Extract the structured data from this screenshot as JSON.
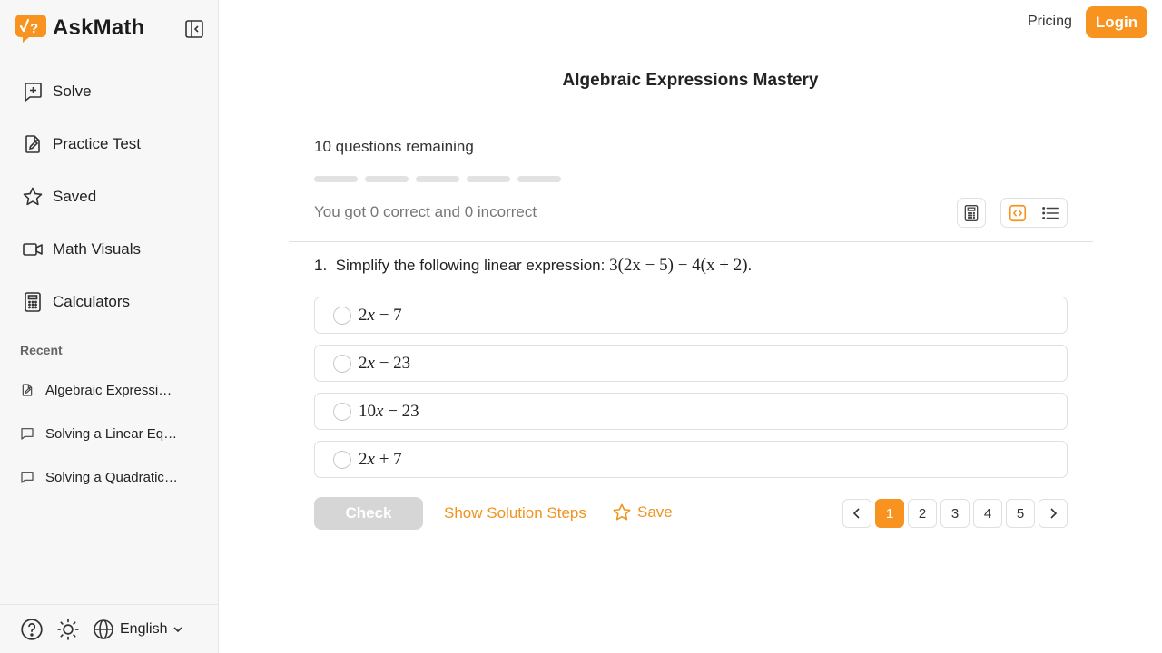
{
  "brand": {
    "name": "AskMath"
  },
  "nav": {
    "items": [
      {
        "label": "Solve",
        "icon": "solve-icon"
      },
      {
        "label": "Practice Test",
        "icon": "practice-test-icon"
      },
      {
        "label": "Saved",
        "icon": "star-icon"
      },
      {
        "label": "Math Visuals",
        "icon": "video-icon"
      },
      {
        "label": "Calculators",
        "icon": "calculator-icon"
      }
    ]
  },
  "recent": {
    "title": "Recent",
    "items": [
      {
        "label": "Algebraic Expressions Mastery",
        "icon": "practice-test-icon"
      },
      {
        "label": "Solving a Linear Equation",
        "icon": "chat-icon"
      },
      {
        "label": "Solving a Quadratic Equation",
        "icon": "chat-icon"
      }
    ]
  },
  "footer": {
    "language": "English"
  },
  "header": {
    "pricing": "Pricing",
    "login": "Login"
  },
  "colors": {
    "accent": "#f7931e",
    "disabled": "#d6d6d6"
  },
  "test": {
    "title": "Algebraic Expressions Mastery",
    "remaining": "10 questions remaining",
    "score": "You got 0 correct and 0 incorrect",
    "progress_total": 5
  },
  "question": {
    "number": "1.",
    "text": "Simplify the following linear expression:",
    "expression": "3(2x − 5) − 4(x + 2)",
    "choices": [
      {
        "parts": [
          "2",
          "x",
          " − 7"
        ]
      },
      {
        "parts": [
          "2",
          "x",
          " − 23"
        ]
      },
      {
        "parts": [
          "10",
          "x",
          " − 23"
        ]
      },
      {
        "parts": [
          "2",
          "x",
          " + 7"
        ]
      }
    ]
  },
  "actions": {
    "check": "Check",
    "solution": "Show Solution Steps",
    "save": "Save"
  },
  "pagination": {
    "pages": [
      "1",
      "2",
      "3",
      "4",
      "5"
    ],
    "current": "1"
  }
}
